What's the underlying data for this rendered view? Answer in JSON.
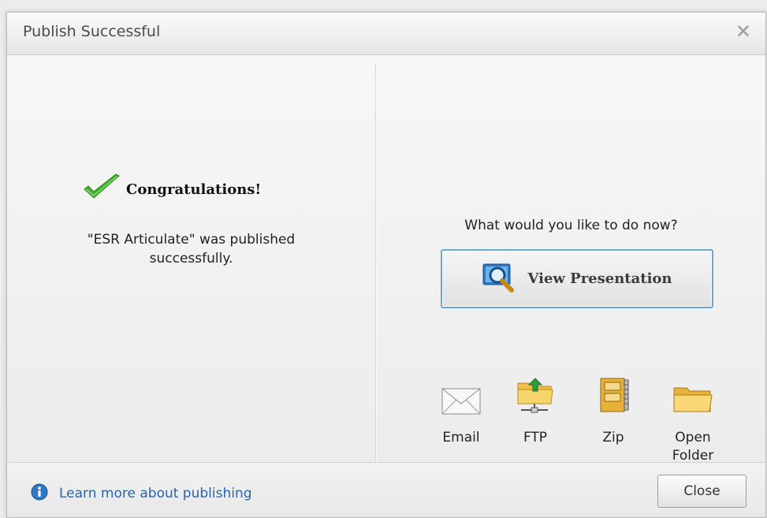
{
  "dialog": {
    "title": "Publish Successful",
    "close_glyph": "✕"
  },
  "left": {
    "heading": "Congratulations!",
    "message_line1": "\"ESR Articulate\" was published",
    "message_line2": "successfully."
  },
  "right": {
    "prompt": "What would you like to do now?",
    "view_label": "View Presentation",
    "actions": [
      {
        "label": "Email",
        "icon": "envelope-icon"
      },
      {
        "label": "FTP",
        "icon": "ftp-folder-icon"
      },
      {
        "label": "Zip",
        "icon": "zip-archive-icon"
      },
      {
        "label_line1": "Open",
        "label_line2": "Folder",
        "icon": "folder-icon"
      }
    ]
  },
  "footer": {
    "learn_more": "Learn more about publishing",
    "close_label": "Close"
  },
  "colors": {
    "link": "#2a63a8",
    "button_border_accent": "#6aa7cf",
    "checkmark": "#3fae2a"
  }
}
